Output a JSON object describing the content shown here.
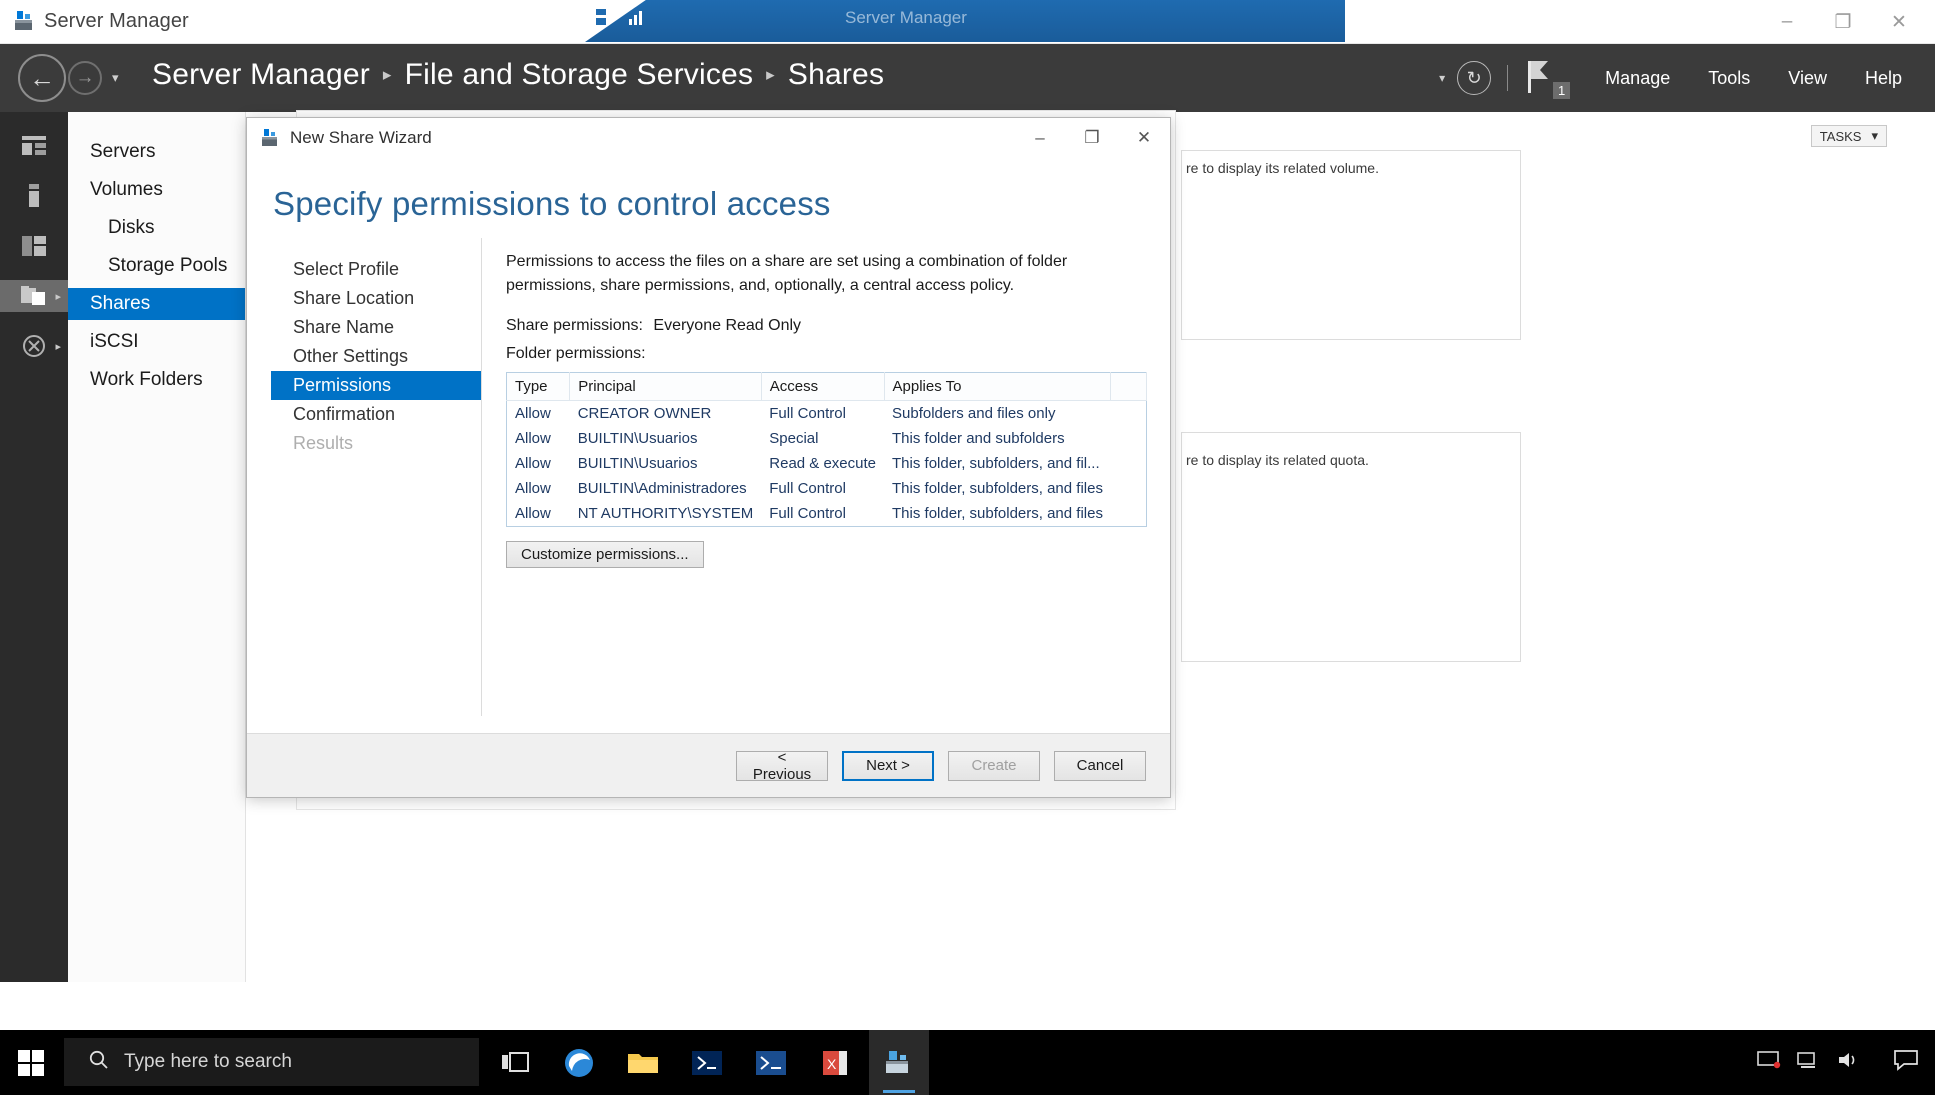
{
  "os_titlebar": {
    "title": "Server Manager",
    "app_icon": "server-manager-icon",
    "minimize": "–",
    "maximize": "❐",
    "close": "✕",
    "notch_title": "Server Manager",
    "notch_minimize": "–",
    "notch_maximize": "❐",
    "notch_close": "✕"
  },
  "header": {
    "back": "←",
    "forward": "→",
    "caret": "▾",
    "breadcrumb": [
      "Server Manager",
      "File and Storage Services",
      "Shares"
    ],
    "separator": "▸",
    "dropdown_caret": "▾",
    "refresh": "↻",
    "notification_count": "1",
    "menu": [
      "Manage",
      "Tools",
      "View",
      "Help"
    ]
  },
  "rail": {
    "items": [
      {
        "name": "dashboard",
        "expandable": false,
        "active": false
      },
      {
        "name": "volumes",
        "expandable": false,
        "active": false
      },
      {
        "name": "disks",
        "expandable": false,
        "active": false
      },
      {
        "name": "shares",
        "expandable": true,
        "active": true
      },
      {
        "name": "iscsi",
        "expandable": true,
        "active": false
      }
    ],
    "arrow": "▸"
  },
  "navpane": {
    "items": [
      {
        "label": "Servers",
        "indent": false,
        "selected": false
      },
      {
        "label": "Volumes",
        "indent": false,
        "selected": false
      },
      {
        "label": "Disks",
        "indent": true,
        "selected": false
      },
      {
        "label": "Storage Pools",
        "indent": true,
        "selected": false
      },
      {
        "label": "Shares",
        "indent": false,
        "selected": true
      },
      {
        "label": "iSCSI",
        "indent": false,
        "selected": false
      },
      {
        "label": "Work Folders",
        "indent": false,
        "selected": false
      }
    ]
  },
  "content": {
    "tasks_label": "TASKS",
    "tasks_caret": "▾",
    "volume_hint": "re to display its related volume.",
    "quota_hint": "re to display its related quota."
  },
  "wizard": {
    "title": "New Share Wizard",
    "title_icon": "share-wizard-icon",
    "minimize": "–",
    "maximize": "❐",
    "close": "✕",
    "heading": "Specify permissions to control access",
    "steps": [
      {
        "label": "Select Profile",
        "state": "normal"
      },
      {
        "label": "Share Location",
        "state": "normal"
      },
      {
        "label": "Share Name",
        "state": "normal"
      },
      {
        "label": "Other Settings",
        "state": "normal"
      },
      {
        "label": "Permissions",
        "state": "active"
      },
      {
        "label": "Confirmation",
        "state": "normal"
      },
      {
        "label": "Results",
        "state": "disabled"
      }
    ],
    "intro": "Permissions to access the files on a share are set using a combination of folder permissions, share permissions, and, optionally, a central access policy.",
    "share_permissions_label": "Share permissions:",
    "share_permissions_value": "Everyone Read Only",
    "folder_permissions_label": "Folder permissions:",
    "table": {
      "columns": [
        "Type",
        "Principal",
        "Access",
        "Applies To",
        ""
      ],
      "rows": [
        {
          "type": "Allow",
          "principal": "CREATOR OWNER",
          "access": "Full Control",
          "applies_to": "Subfolders and files only"
        },
        {
          "type": "Allow",
          "principal": "BUILTIN\\Usuarios",
          "access": "Special",
          "applies_to": "This folder and subfolders"
        },
        {
          "type": "Allow",
          "principal": "BUILTIN\\Usuarios",
          "access": "Read & execute",
          "applies_to": "This folder, subfolders, and fil..."
        },
        {
          "type": "Allow",
          "principal": "BUILTIN\\Administradores",
          "access": "Full Control",
          "applies_to": "This folder, subfolders, and files"
        },
        {
          "type": "Allow",
          "principal": "NT AUTHORITY\\SYSTEM",
          "access": "Full Control",
          "applies_to": "This folder, subfolders, and files"
        }
      ]
    },
    "customize_button": "Customize permissions...",
    "footer": {
      "previous": "< Previous",
      "next": "Next >",
      "create": "Create",
      "cancel": "Cancel"
    }
  },
  "taskbar": {
    "start_icon": "windows-start-icon",
    "search_icon": "search-icon",
    "search_placeholder": "Type here to search",
    "items": [
      {
        "name": "task-view-icon",
        "active": false
      },
      {
        "name": "edge-browser-icon",
        "active": false
      },
      {
        "name": "file-explorer-icon",
        "active": false
      },
      {
        "name": "powershell-icon",
        "active": false
      },
      {
        "name": "powershell-ise-icon",
        "active": false
      },
      {
        "name": "excel-icon",
        "active": false
      },
      {
        "name": "server-manager-icon",
        "active": true
      }
    ],
    "tray": {
      "screen_icon": "screen-share-icon",
      "network_icon": "network-icon",
      "volume_icon": "volume-icon",
      "action_center_icon": "action-center-icon"
    }
  },
  "colors": {
    "accent": "#0072c6",
    "header_bg": "#3b3b3b",
    "rail_bg": "#2b2b2b",
    "heading_blue": "#2a6496",
    "table_text": "#1f3a63"
  }
}
